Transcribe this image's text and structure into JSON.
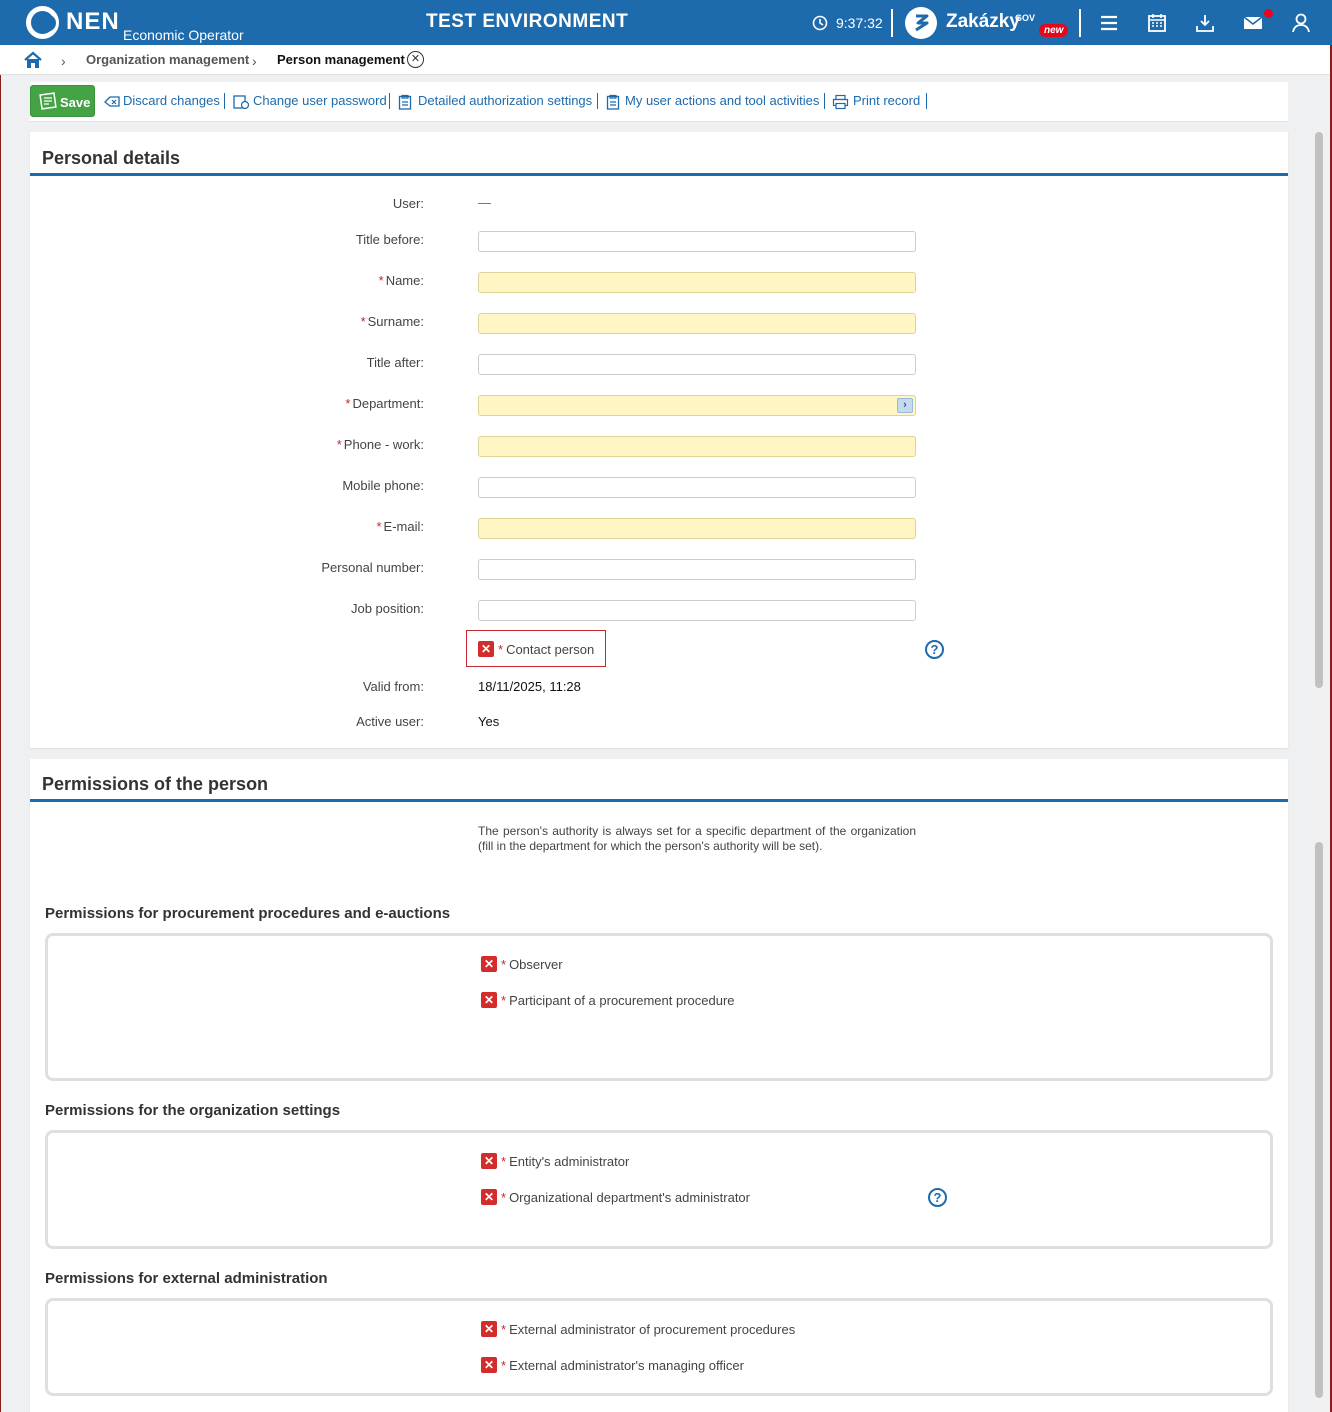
{
  "header": {
    "brand": "NEN",
    "brand_sub": "Economic Operator",
    "environment": "TEST ENVIRONMENT",
    "clock": "9:37:32",
    "zakazky": "Zakázky",
    "zakazky_gov": "GOV",
    "zakazky_new": "new",
    "accent": "#1d6aad",
    "icons": [
      "clock-icon",
      "zakazky-logo-icon",
      "menu-icon",
      "calendar-icon",
      "download-icon",
      "mail-icon",
      "user-icon"
    ]
  },
  "breadcrumb": {
    "items": [
      "Organization management",
      "Person management"
    ]
  },
  "toolbar": {
    "save": "Save",
    "discard": "Discard changes",
    "change_password": "Change user password",
    "authorization": "Detailed authorization settings",
    "activities": "My user actions and tool activities",
    "print": "Print record"
  },
  "personal": {
    "title": "Personal details",
    "fields": {
      "user_label": "User",
      "user_value": "—",
      "title_before": "Title before",
      "name": "Name",
      "surname": "Surname",
      "title_after": "Title after",
      "department": "Department",
      "phone_work": "Phone - work",
      "mobile": "Mobile phone",
      "email": "E-mail",
      "personal_number": "Personal number",
      "job_position": "Job position",
      "contact_person": "Contact person",
      "valid_from_label": "Valid from",
      "valid_from_value": "18/11/2025, 11:28",
      "active_label": "Active user",
      "active_value": "Yes"
    },
    "required_color": "#fff6c4"
  },
  "permissions": {
    "title": "Permissions of the person",
    "note": "The person's authority is always set for a specific department of the organization (fill in the department for which the person's authority will be set).",
    "sections": [
      {
        "title": "Permissions for procurement procedures and e-auctions",
        "items": [
          "Observer",
          "Participant of a procurement procedure"
        ]
      },
      {
        "title": "Permissions for the organization settings",
        "items": [
          "Entity's administrator",
          "Organizational department's administrator"
        ]
      },
      {
        "title": "Permissions for external administration",
        "items": [
          "External administrator of procurement procedures",
          "External administrator's managing officer"
        ]
      }
    ]
  }
}
